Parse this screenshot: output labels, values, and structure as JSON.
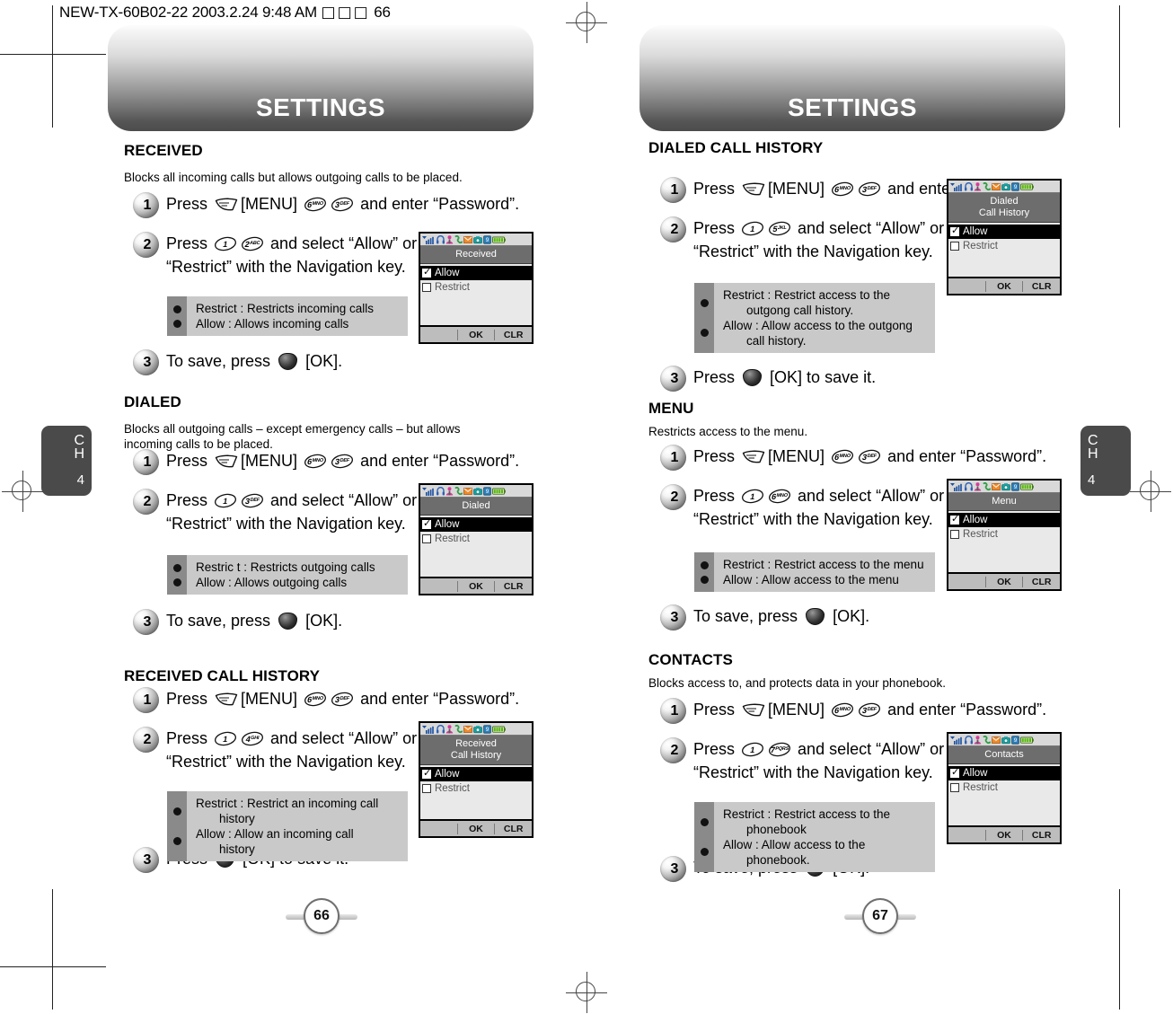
{
  "file_stamp": {
    "text": "NEW-TX-60B02-22  2003.2.24 9:48 AM",
    "glyphs": "□□□",
    "page": "66"
  },
  "chapter_tab": {
    "c": "C",
    "h": "H",
    "number": "4"
  },
  "pages": [
    {
      "banner_title": "SETTINGS",
      "page_number": "66",
      "sections": [
        {
          "title": "RECEIVED",
          "desc": "Blocks all incoming calls but allows outgoing calls to be placed.",
          "steps": [
            {
              "num": "1",
              "text_pre": "Press",
              "key_menu": true,
              "menu_label": "[MENU]",
              "keys": [
                "6MNO",
                "3DEF"
              ],
              "text_post": "and enter “Password”."
            },
            {
              "num": "2",
              "text_pre": "Press",
              "keys": [
                "1",
                "2ABC"
              ],
              "text_post": "and select “Allow” or “Restrict” with the Navigation key."
            },
            {
              "num": "3",
              "text_pre": "To save, press",
              "ok_key": true,
              "text_post": "[OK]."
            }
          ],
          "note": [
            {
              "line": "Restrict : Restricts incoming calls",
              "cont": ""
            },
            {
              "line": " Allow : Allows incoming calls",
              "cont": ""
            }
          ],
          "phone": {
            "title": "Received",
            "title2": "",
            "items": [
              {
                "label": "Allow",
                "checked": true,
                "selected": true
              },
              {
                "label": "Restrict",
                "checked": false,
                "selected": false
              }
            ],
            "softkeys": [
              "",
              "OK",
              "CLR"
            ]
          }
        },
        {
          "title": "DIALED",
          "desc": "Blocks all outgoing calls – except emergency calls – but allows incoming calls to be placed.",
          "steps": [
            {
              "num": "1",
              "text_pre": "Press",
              "key_menu": true,
              "menu_label": "[MENU]",
              "keys": [
                "6MNO",
                "3DEF"
              ],
              "text_post": "and enter “Password”."
            },
            {
              "num": "2",
              "text_pre": "Press",
              "keys": [
                "1",
                "3DEF"
              ],
              "text_post": "and select “Allow” or “Restrict” with the Navigation key."
            },
            {
              "num": "3",
              "text_pre": "To save, press",
              "ok_key": true,
              "text_post": "[OK]."
            }
          ],
          "note": [
            {
              "line": "Restric t : Restricts outgoing calls",
              "cont": ""
            },
            {
              "line": "Allow : Allows outgoing calls",
              "cont": ""
            }
          ],
          "phone": {
            "title": "Dialed",
            "title2": "",
            "items": [
              {
                "label": "Allow",
                "checked": true,
                "selected": true
              },
              {
                "label": "Restrict",
                "checked": false,
                "selected": false
              }
            ],
            "softkeys": [
              "",
              "OK",
              "CLR"
            ]
          }
        },
        {
          "title": "RECEIVED CALL HISTORY",
          "desc": "",
          "steps": [
            {
              "num": "1",
              "text_pre": "Press",
              "key_menu": true,
              "menu_label": "[MENU]",
              "keys": [
                "6MNO",
                "3DEF"
              ],
              "text_post": "and enter “Password”."
            },
            {
              "num": "2",
              "text_pre": "Press",
              "keys": [
                "1",
                "4GHI"
              ],
              "text_post": "and select “Allow” or “Restrict” with the Navigation key."
            },
            {
              "num": "3",
              "text_pre": "Press",
              "ok_key": true,
              "text_post": "[OK] to save it."
            }
          ],
          "note": [
            {
              "line": "Restrict : Restrict an incoming call",
              "cont": "history"
            },
            {
              "line": "Allow : Allow an incoming call",
              "cont": "history"
            }
          ],
          "phone": {
            "title": "Received",
            "title2": "Call History",
            "items": [
              {
                "label": "Allow",
                "checked": true,
                "selected": true
              },
              {
                "label": "Restrict",
                "checked": false,
                "selected": false
              }
            ],
            "softkeys": [
              "",
              "OK",
              "CLR"
            ]
          }
        }
      ]
    },
    {
      "banner_title": "SETTINGS",
      "page_number": "67",
      "sections": [
        {
          "title": "DIALED CALL HISTORY",
          "desc": "",
          "steps": [
            {
              "num": "1",
              "text_pre": "Press",
              "key_menu": true,
              "menu_label": "[MENU]",
              "keys": [
                "6MNO",
                "3DEF"
              ],
              "text_post": "and enter “Password”."
            },
            {
              "num": "2",
              "text_pre": "Press",
              "keys": [
                "1",
                "5JKL"
              ],
              "text_post": "and select “Allow” or “Restrict” with the Navigation key."
            },
            {
              "num": "3",
              "text_pre": "Press",
              "ok_key": true,
              "text_post": "[OK] to save it."
            }
          ],
          "note": [
            {
              "line": "Restrict : Restrict access to the",
              "cont": "outgong call history."
            },
            {
              "line": "Allow : Allow access to the outgong",
              "cont": "call history."
            }
          ],
          "phone": {
            "title": "Dialed",
            "title2": "Call History",
            "items": [
              {
                "label": "Allow",
                "checked": true,
                "selected": true
              },
              {
                "label": "Restrict",
                "checked": false,
                "selected": false
              }
            ],
            "softkeys": [
              "",
              "OK",
              "CLR"
            ]
          }
        },
        {
          "title": "MENU",
          "desc": "Restricts access to the menu.",
          "steps": [
            {
              "num": "1",
              "text_pre": "Press",
              "key_menu": true,
              "menu_label": "[MENU]",
              "keys": [
                "6MNO",
                "3DEF"
              ],
              "text_post": "and enter “Password”."
            },
            {
              "num": "2",
              "text_pre": "Press",
              "keys": [
                "1",
                "6MNO"
              ],
              "text_post": "and select “Allow” or “Restrict” with the Navigation key."
            },
            {
              "num": "3",
              "text_pre": "To save, press",
              "ok_key": true,
              "text_post": "[OK]."
            }
          ],
          "note": [
            {
              "line": "Restrict : Restrict access to the menu",
              "cont": ""
            },
            {
              "line": "Allow : Allow access to the menu",
              "cont": ""
            }
          ],
          "phone": {
            "title": "Menu",
            "title2": "",
            "items": [
              {
                "label": "Allow",
                "checked": true,
                "selected": true
              },
              {
                "label": "Restrict",
                "checked": false,
                "selected": false
              }
            ],
            "softkeys": [
              "",
              "OK",
              "CLR"
            ]
          }
        },
        {
          "title": "CONTACTS",
          "desc": "Blocks access to, and protects data in your phonebook.",
          "steps": [
            {
              "num": "1",
              "text_pre": "Press",
              "key_menu": true,
              "menu_label": "[MENU]",
              "keys": [
                "6MNO",
                "3DEF"
              ],
              "text_post": "and enter “Password”."
            },
            {
              "num": "2",
              "text_pre": "Press",
              "keys": [
                "1",
                "7PQRS"
              ],
              "text_post": "and select “Allow” or “Restrict” with the Navigation key."
            },
            {
              "num": "3",
              "text_pre": "To save, press",
              "ok_key": true,
              "text_post": "[OK]."
            }
          ],
          "note": [
            {
              "line": "Restrict : Restrict access to the",
              "cont": "phonebook"
            },
            {
              "line": "Allow : Allow access to the",
              "cont": "phonebook."
            }
          ],
          "phone": {
            "title": "Contacts",
            "title2": "",
            "items": [
              {
                "label": "Allow",
                "checked": true,
                "selected": true
              },
              {
                "label": "Restrict",
                "checked": false,
                "selected": false
              }
            ],
            "softkeys": [
              "",
              "OK",
              "CLR"
            ]
          }
        }
      ]
    }
  ],
  "status_icons": [
    "signal-bars",
    "headset",
    "person",
    "call",
    "envelope",
    "camera",
    "alarm",
    "battery"
  ],
  "colors": {
    "banner_dark": "#4c4c4c",
    "note_body": "#c9c9c9",
    "note_strip": "#8a8a8a",
    "phone_title_bar": "#6d6d6d",
    "tab_bg": "#4a4a4a"
  }
}
